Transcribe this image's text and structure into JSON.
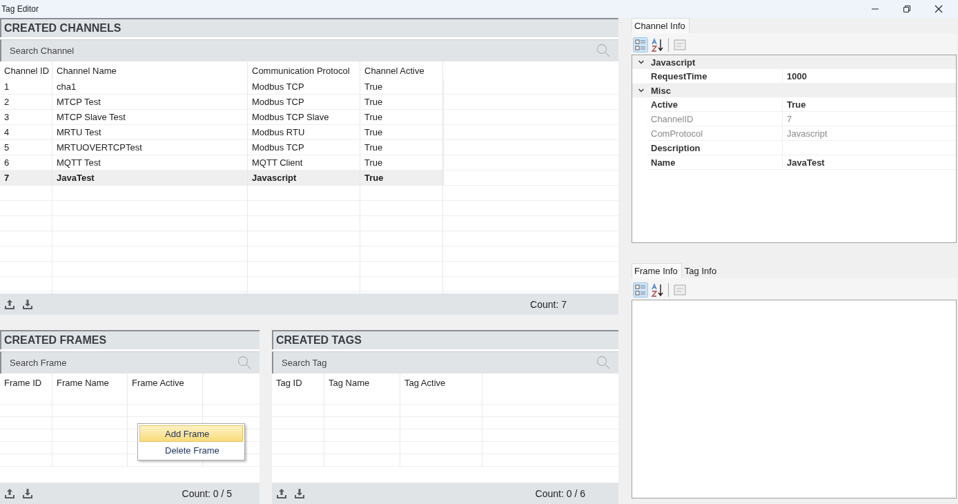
{
  "window": {
    "title": "Tag Editor"
  },
  "channels": {
    "title": "CREATED CHANNELS",
    "search": {
      "placeholder": "Search Channel"
    },
    "columns": [
      "Channel ID",
      "Channel Name",
      "Communication Protocol",
      "Channel Active"
    ],
    "rows": [
      {
        "cells": [
          "1",
          "cha1",
          "Modbus TCP",
          "True"
        ],
        "selected": false
      },
      {
        "cells": [
          "2",
          "MTCP Test",
          "Modbus TCP",
          "True"
        ],
        "selected": false
      },
      {
        "cells": [
          "3",
          "MTCP Slave Test",
          "Modbus TCP Slave",
          "True"
        ],
        "selected": false
      },
      {
        "cells": [
          "4",
          "MRTU Test",
          "Modbus RTU",
          "True"
        ],
        "selected": false
      },
      {
        "cells": [
          "5",
          "MRTUOVERTCPTest",
          "Modbus TCP",
          "True"
        ],
        "selected": false
      },
      {
        "cells": [
          "6",
          "MQTT Test",
          "MQTT Client",
          "True"
        ],
        "selected": false
      },
      {
        "cells": [
          "7",
          "JavaTest",
          "Javascript",
          "True"
        ],
        "selected": true
      }
    ],
    "count": "Count: 7"
  },
  "frames": {
    "title": "CREATED FRAMES",
    "search": {
      "placeholder": "Search Frame"
    },
    "columns": [
      "Frame ID",
      "Frame Name",
      "Frame Active"
    ],
    "count": "Count: 0 / 5"
  },
  "tags": {
    "title": "CREATED TAGS",
    "search": {
      "placeholder": "Search Tag"
    },
    "columns": [
      "Tag ID",
      "Tag Name",
      "Tag Active"
    ],
    "count": "Count: 0 / 6"
  },
  "context_menu": [
    {
      "label": "Add Frame",
      "selected": true
    },
    {
      "label": "Delete Frame",
      "selected": false
    }
  ],
  "channel_info": {
    "tabs": [
      {
        "label": "Channel Info",
        "selected": true
      }
    ],
    "categories": [
      {
        "name": "Javascript",
        "expanded": true,
        "properties": [
          {
            "name": "RequestTime",
            "value": "1000",
            "disabled": false
          }
        ]
      },
      {
        "name": "Misc",
        "expanded": true,
        "properties": [
          {
            "name": "Active",
            "value": "True",
            "disabled": false
          },
          {
            "name": "ChannelID",
            "value": "7",
            "disabled": true
          },
          {
            "name": "ComProtocol",
            "value": "Javascript",
            "disabled": true
          },
          {
            "name": "Description",
            "disabled": false
          },
          {
            "name": "Name",
            "value": "JavaTest",
            "disabled": false
          }
        ]
      }
    ]
  },
  "frame_info": {
    "tabs": [
      {
        "label": "Frame Info",
        "selected": true
      },
      {
        "label": "Tag Info",
        "selected": false
      }
    ]
  }
}
